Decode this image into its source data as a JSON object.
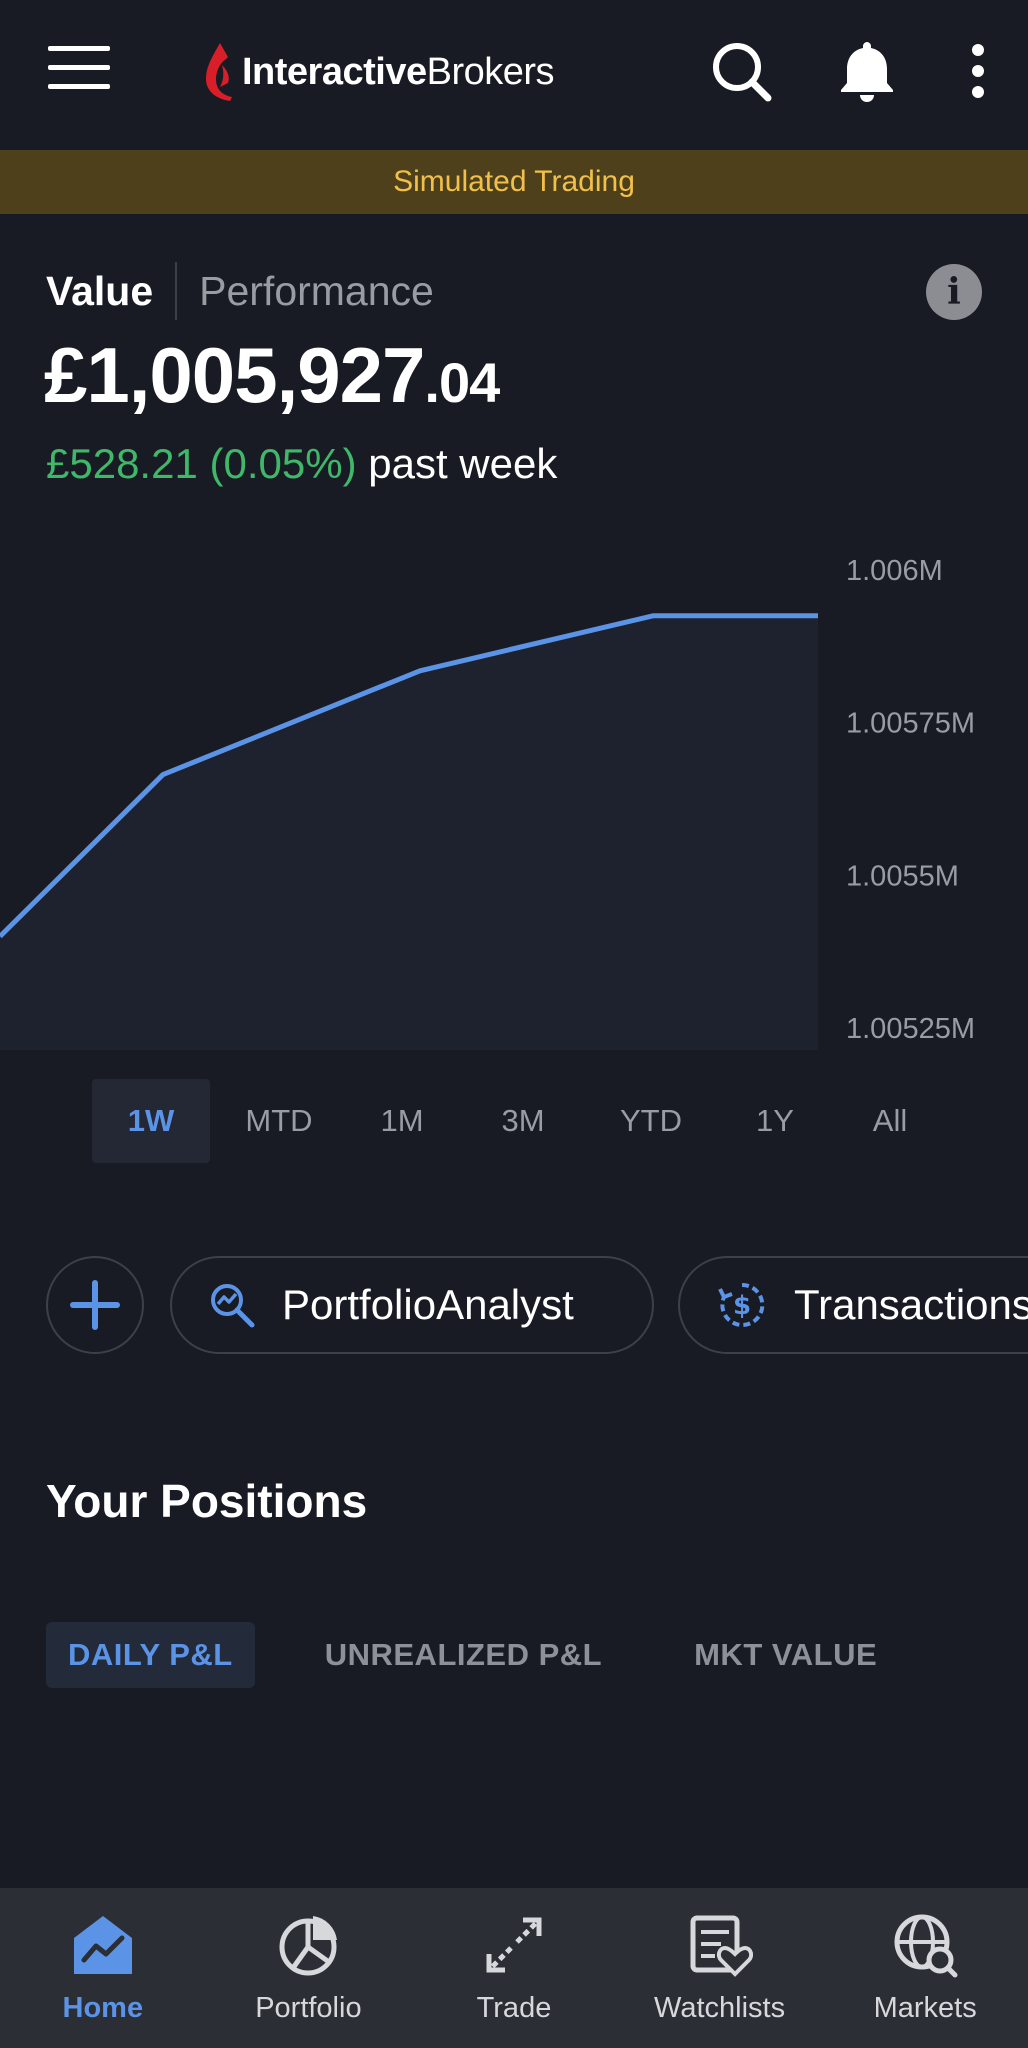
{
  "header": {
    "logo_bold": "Interactive",
    "logo_rest": "Brokers",
    "brand_color": "#d81e28"
  },
  "banner": {
    "text": "Simulated Trading"
  },
  "value_section": {
    "tab_value": "Value",
    "tab_performance": "Performance",
    "info_glyph": "i",
    "balance_main": "£1,005,927",
    "balance_cents": ".04",
    "change_amount": "£528.21 (0.05%)",
    "change_label": " past week",
    "gain_color": "#3fb86a"
  },
  "chart_data": {
    "type": "area",
    "x": [
      0,
      1,
      2,
      3,
      4
    ],
    "values": [
      1005400,
      1005665,
      1005835,
      1005925,
      1005925
    ],
    "ytick_labels": [
      "1.006M",
      "1.00575M",
      "1.0055M",
      "1.00525M"
    ],
    "ytick_values": [
      1006000,
      1005750,
      1005500,
      1005250
    ],
    "ylim": [
      1005250,
      1006000
    ],
    "line_color": "#5b93e6"
  },
  "range_tabs": [
    {
      "label": "1W",
      "active": true
    },
    {
      "label": "MTD",
      "active": false
    },
    {
      "label": "1M",
      "active": false
    },
    {
      "label": "3M",
      "active": false
    },
    {
      "label": "YTD",
      "active": false
    },
    {
      "label": "1Y",
      "active": false
    },
    {
      "label": "All",
      "active": false
    }
  ],
  "actions": {
    "portfolio_analyst": "PortfolioAnalyst",
    "transactions": "Transactions"
  },
  "positions": {
    "title": "Your Positions",
    "tabs": [
      {
        "label": "DAILY P&L",
        "active": true
      },
      {
        "label": "UNREALIZED P&L",
        "active": false
      },
      {
        "label": "MKT VALUE",
        "active": false
      }
    ]
  },
  "bottom_nav": [
    {
      "label": "Home",
      "icon": "home-chart-icon",
      "active": true
    },
    {
      "label": "Portfolio",
      "icon": "pie-chart-icon",
      "active": false
    },
    {
      "label": "Trade",
      "icon": "trade-arrows-icon",
      "active": false
    },
    {
      "label": "Watchlists",
      "icon": "watchlist-heart-icon",
      "active": false
    },
    {
      "label": "Markets",
      "icon": "globe-search-icon",
      "active": false
    }
  ]
}
